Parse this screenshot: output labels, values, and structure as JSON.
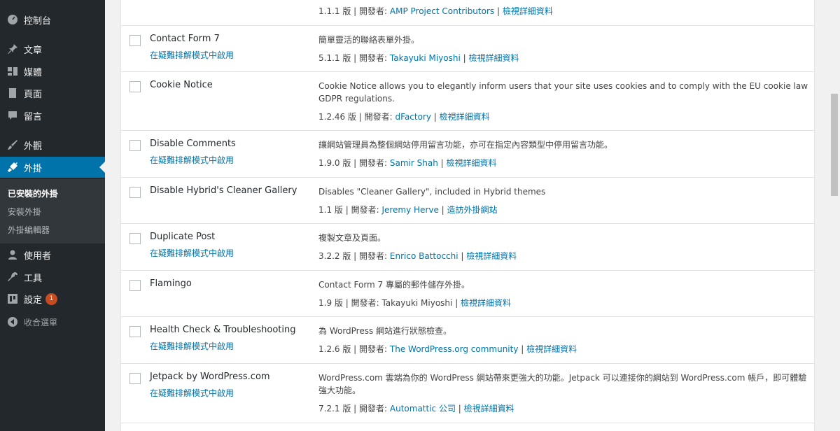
{
  "sidebar": {
    "items": [
      {
        "label": "控制台",
        "icon": "dashboard-icon"
      },
      {
        "label": "文章",
        "icon": "pin-icon"
      },
      {
        "label": "媒體",
        "icon": "media-icon"
      },
      {
        "label": "頁面",
        "icon": "page-icon"
      },
      {
        "label": "留言",
        "icon": "comment-icon"
      },
      {
        "label": "外觀",
        "icon": "brush-icon"
      },
      {
        "label": "外掛",
        "icon": "plugin-icon"
      },
      {
        "label": "使用者",
        "icon": "user-icon"
      },
      {
        "label": "工具",
        "icon": "wrench-icon"
      },
      {
        "label": "設定",
        "icon": "settings-icon",
        "badge": "1"
      },
      {
        "label": "收合選單",
        "icon": "collapse-icon"
      }
    ],
    "submenu": [
      "已安裝的外掛",
      "安裝外掛",
      "外掛編輯器"
    ],
    "accent": "#0073aa",
    "badge_color": "#ca4a1f"
  },
  "strings": {
    "version_suffix": " 版 | 開發者: ",
    "sep": " | ",
    "view_details": "檢視詳細資料",
    "visit_site": "造訪外掛網站",
    "troubleshoot": "在疑難排解模式中啟用"
  },
  "plugins": [
    {
      "name": "",
      "action": "",
      "desc": "",
      "version": "1.1.1",
      "author": "AMP Project Contributors",
      "link": "檢視詳細資料"
    },
    {
      "name": "Contact Form 7",
      "action": "在疑難排解模式中啟用",
      "desc": "簡單靈活的聯絡表單外掛。",
      "version": "5.1.1",
      "author": "Takayuki Miyoshi",
      "link": "檢視詳細資料"
    },
    {
      "name": "Cookie Notice",
      "action": "",
      "desc": "Cookie Notice allows you to elegantly inform users that your site uses cookies and to comply with the EU cookie law GDPR regulations.",
      "version": "1.2.46",
      "author": "dFactory",
      "link": "檢視詳細資料"
    },
    {
      "name": "Disable Comments",
      "action": "在疑難排解模式中啟用",
      "desc": "讓網站管理員為整個網站停用留言功能，亦可在指定內容類型中停用留言功能。",
      "version": "1.9.0",
      "author": "Samir Shah",
      "link": "檢視詳細資料"
    },
    {
      "name": "Disable Hybrid's Cleaner Gallery",
      "action": "",
      "desc": "Disables \"Cleaner Gallery\", included in Hybrid themes",
      "version": "1.1",
      "author": "Jeremy Herve",
      "link": "造訪外掛網站"
    },
    {
      "name": "Duplicate Post",
      "action": "在疑難排解模式中啟用",
      "desc": "複製文章及頁面。",
      "version": "3.2.2",
      "author": "Enrico Battocchi",
      "link": "檢視詳細資料"
    },
    {
      "name": "Flamingo",
      "action": "",
      "desc": "Contact Form 7 專屬的郵件儲存外掛。",
      "version": "1.9",
      "author": "Takayuki Miyoshi",
      "author_plain": true,
      "link": "檢視詳細資料"
    },
    {
      "name": "Health Check & Troubleshooting",
      "action": "在疑難排解模式中啟用",
      "desc": "為 WordPress 網站進行狀態檢查。",
      "version": "1.2.6",
      "author": "The WordPress.org community",
      "link": "檢視詳細資料"
    },
    {
      "name": "Jetpack by WordPress.com",
      "action": "在疑難排解模式中啟用",
      "desc": "WordPress.com 雲端為你的 WordPress 網站帶來更強大的功能。Jetpack 可以連接你的網站到 WordPress.com 帳戶，即可體驗強大功能。",
      "version": "7.2.1",
      "author": "Automattic 公司",
      "link": "檢視詳細資料"
    }
  ]
}
